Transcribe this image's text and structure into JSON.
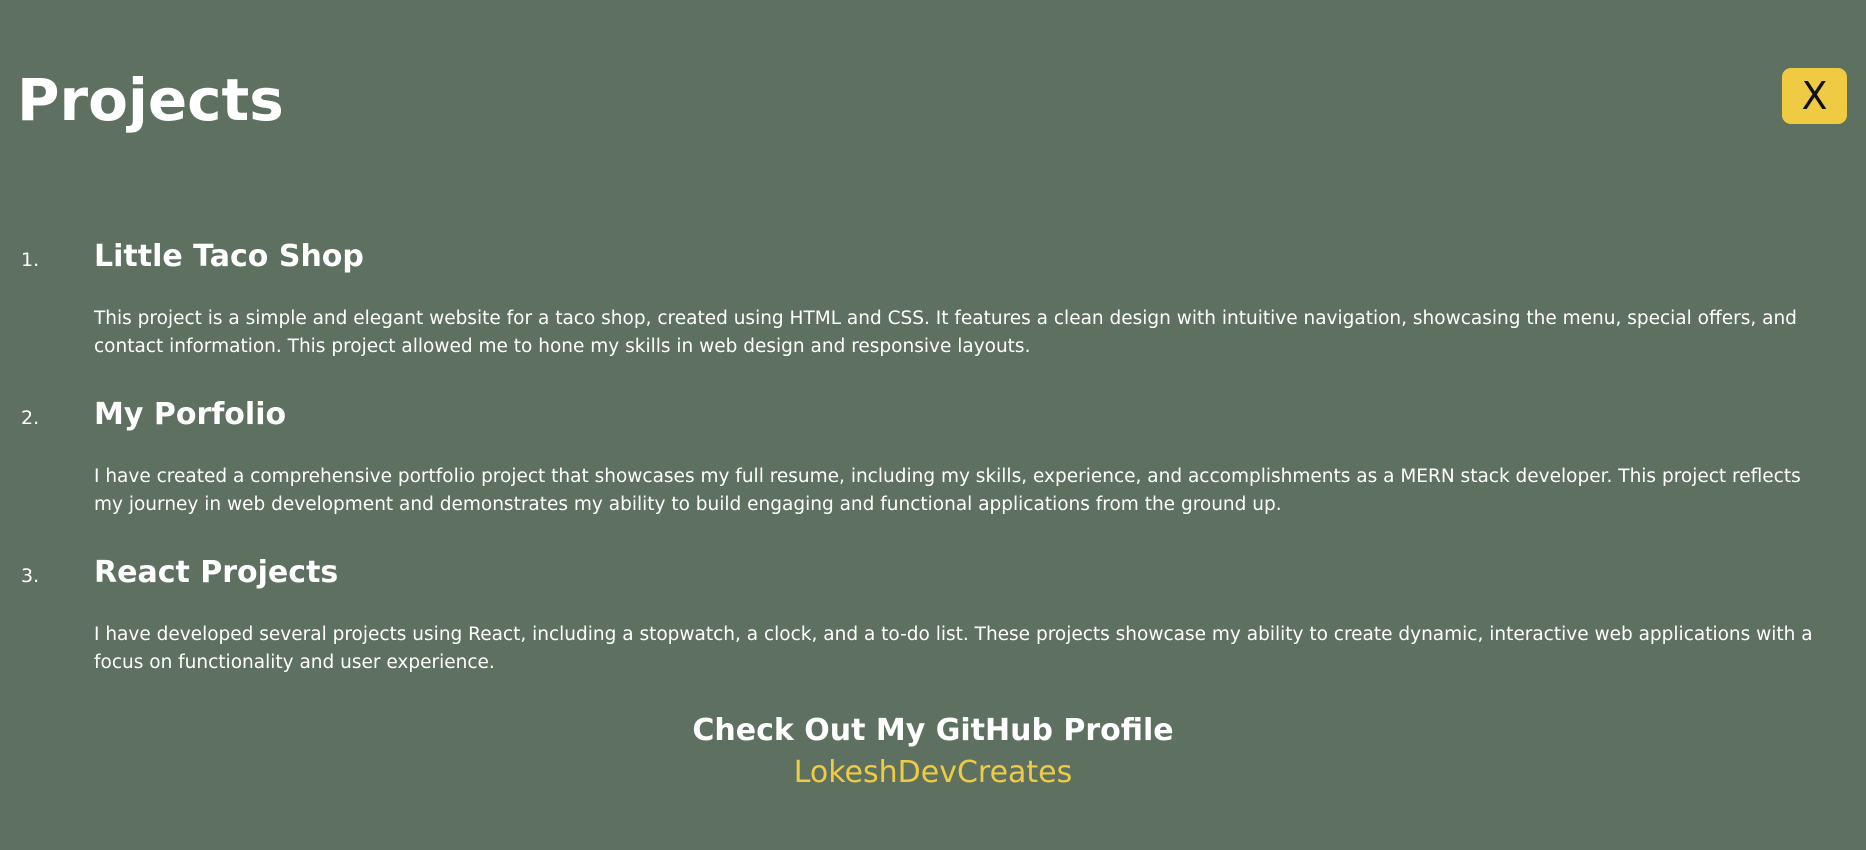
{
  "page": {
    "title": "Projects",
    "close_label": "X"
  },
  "projects": [
    {
      "number": "1.",
      "title": "Little Taco Shop",
      "description": "This project is a simple and elegant website for a taco shop, created using HTML and CSS. It features a clean design with intuitive navigation, showcasing the menu, special offers, and contact information. This project allowed me to hone my skills in web design and responsive layouts."
    },
    {
      "number": "2.",
      "title": "My Porfolio",
      "description": "I have created a comprehensive portfolio project that showcases my full resume, including my skills, experience, and accomplishments as a MERN stack developer. This project reflects my journey in web development and demonstrates my ability to build engaging and functional applications from the ground up."
    },
    {
      "number": "3.",
      "title": "React Projects",
      "description": "I have developed several projects using React, including a stopwatch, a clock, and a to-do list. These projects showcase my ability to create dynamic, interactive web applications with a focus on functionality and user experience."
    }
  ],
  "github": {
    "heading": "Check Out My GitHub Profile",
    "link_text": "LokeshDevCreates"
  },
  "colors": {
    "background": "#5e7161",
    "accent": "#efcb44",
    "text": "#ffffff"
  }
}
